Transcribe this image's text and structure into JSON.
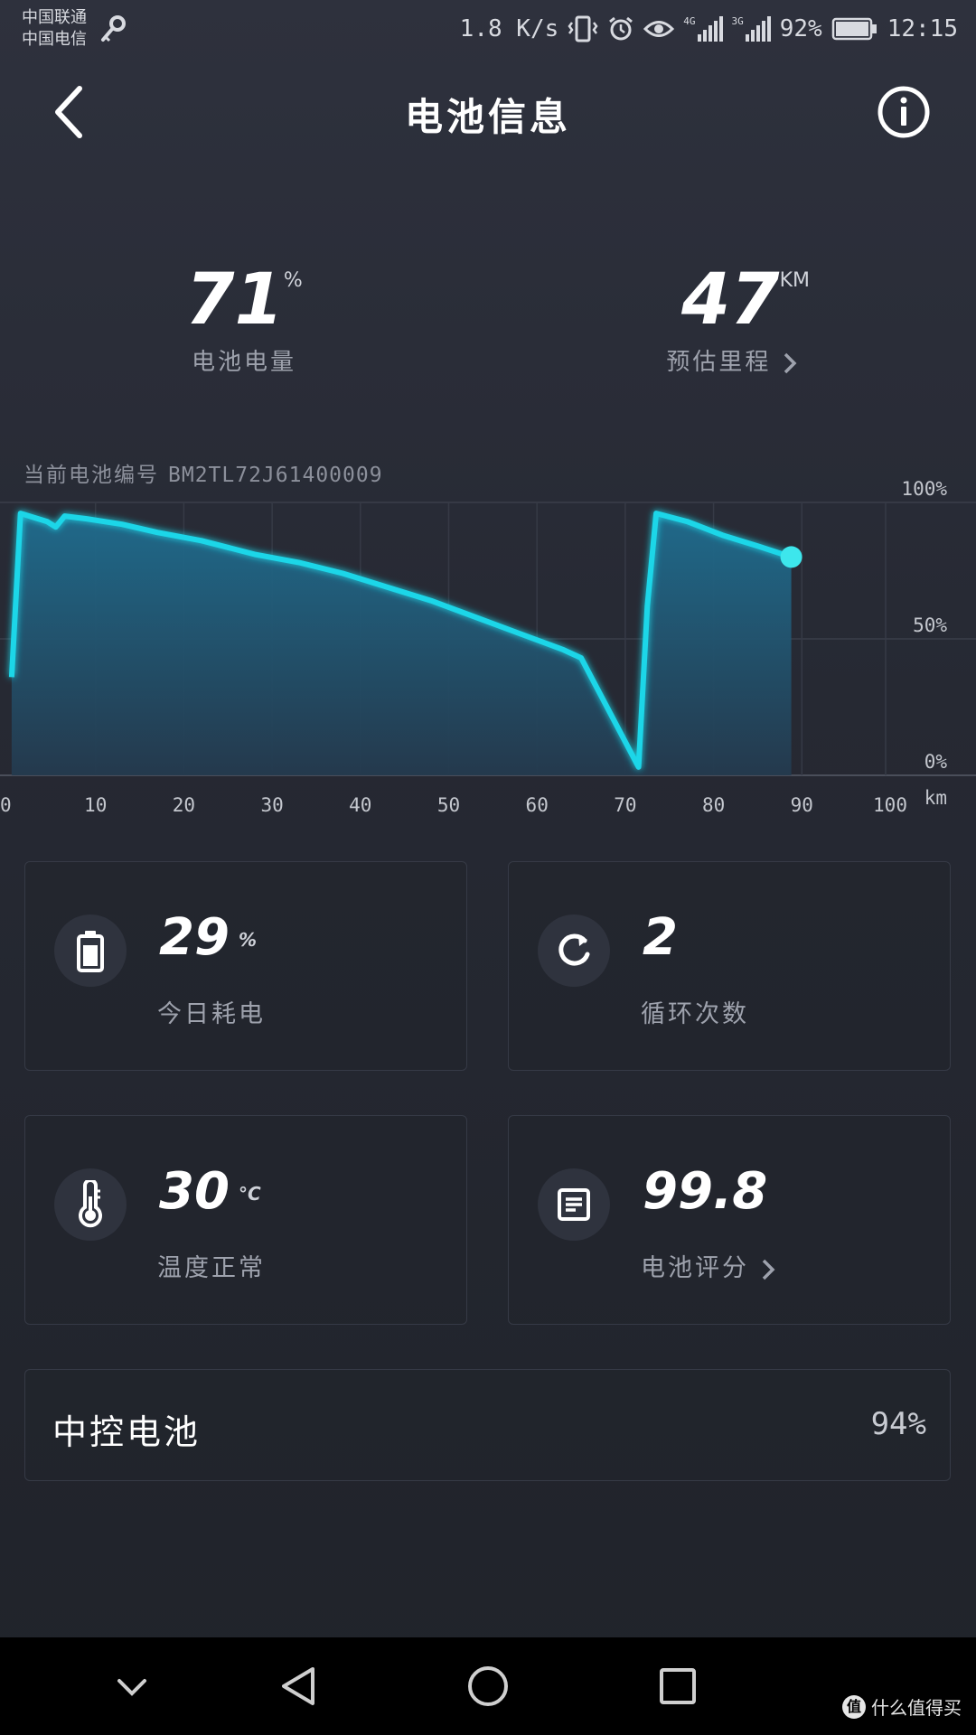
{
  "status_bar": {
    "carrier_1": "中国联通",
    "carrier_2": "中国电信",
    "speed": "1.8 K/s",
    "net_1": "4G",
    "net_2": "3G",
    "battery": "92%",
    "time": "12:15"
  },
  "header": {
    "title": "电池信息",
    "back_icon": "chevron-left-icon",
    "info_icon": "info-icon"
  },
  "stats": {
    "battery_level": {
      "value": "71",
      "unit": "%",
      "label": "电池电量"
    },
    "range": {
      "value": "47",
      "unit": "KM",
      "label": "预估里程"
    }
  },
  "battery_id": {
    "label": "当前电池编号",
    "code": "BM2TL72J61400009"
  },
  "chart_data": {
    "type": "area",
    "x_ticks": [
      "0",
      "10",
      "20",
      "30",
      "40",
      "50",
      "60",
      "70",
      "80",
      "90",
      "100"
    ],
    "x_unit": "km",
    "y_ticks": [
      "100%",
      "50%",
      "0%"
    ],
    "xlim": [
      0,
      100
    ],
    "ylim": [
      0,
      100
    ],
    "grid": true,
    "line_color": "#1fd6e8",
    "fill_color": "#1e5f7e",
    "points": [
      [
        0.5,
        36
      ],
      [
        1.5,
        96
      ],
      [
        4.5,
        93
      ],
      [
        5.5,
        91
      ],
      [
        6.5,
        95
      ],
      [
        9,
        94
      ],
      [
        13,
        92
      ],
      [
        17,
        89
      ],
      [
        22,
        86
      ],
      [
        28,
        81
      ],
      [
        33,
        78
      ],
      [
        38,
        74
      ],
      [
        43,
        69
      ],
      [
        48,
        64
      ],
      [
        53,
        58
      ],
      [
        58,
        52
      ],
      [
        63,
        46
      ],
      [
        65,
        43
      ],
      [
        71.5,
        3
      ],
      [
        72.5,
        62
      ],
      [
        73.5,
        96
      ],
      [
        77,
        93
      ],
      [
        81,
        88
      ],
      [
        85,
        84
      ],
      [
        88.8,
        80
      ]
    ],
    "end_point": [
      88.8,
      80
    ]
  },
  "cards": [
    {
      "icon": "battery-icon",
      "value": "29",
      "unit": "%",
      "label": "今日耗电"
    },
    {
      "icon": "refresh-icon",
      "value": "2",
      "unit": "",
      "label": "循环次数"
    },
    {
      "icon": "thermometer-icon",
      "value": "30",
      "unit": "°C",
      "label": "温度正常"
    },
    {
      "icon": "report-icon",
      "value": "99.8",
      "unit": "",
      "label": "电池评分"
    }
  ],
  "central_battery": {
    "label": "中控电池",
    "value": "94%"
  },
  "watermark": {
    "logo": "值",
    "text": "什么值得买"
  }
}
